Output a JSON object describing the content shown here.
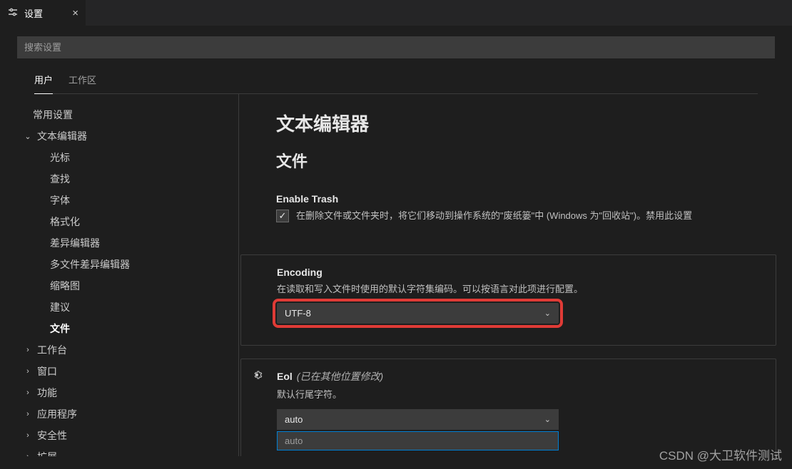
{
  "tab": {
    "title": "设置"
  },
  "search": {
    "placeholder": "搜索设置"
  },
  "scope": {
    "user": "用户",
    "workspace": "工作区"
  },
  "toc": {
    "common": "常用设置",
    "textEditor": "文本编辑器",
    "children": {
      "cursor": "光标",
      "find": "查找",
      "font": "字体",
      "format": "格式化",
      "diff": "差异编辑器",
      "multiDiff": "多文件差异编辑器",
      "minimap": "缩略图",
      "suggest": "建议",
      "files": "文件"
    },
    "workbench": "工作台",
    "window": "窗口",
    "features": "功能",
    "application": "应用程序",
    "security": "安全性",
    "extensions": "扩展"
  },
  "content": {
    "sectionTitle": "文本编辑器",
    "subTitle": "文件",
    "enableTrash": {
      "label": "Enable Trash",
      "desc": "在删除文件或文件夹时，将它们移动到操作系统的\"废纸篓\"中 (Windows 为\"回收站\")。禁用此设置"
    },
    "encoding": {
      "label": "Encoding",
      "desc": "在读取和写入文件时使用的默认字符集编码。可以按语言对此项进行配置。",
      "value": "UTF-8"
    },
    "eol": {
      "label": "Eol",
      "modified": "(已在其他位置修改)",
      "desc": "默认行尾字符。",
      "value": "auto",
      "option": "auto"
    }
  },
  "watermark": "CSDN @大卫软件测试"
}
